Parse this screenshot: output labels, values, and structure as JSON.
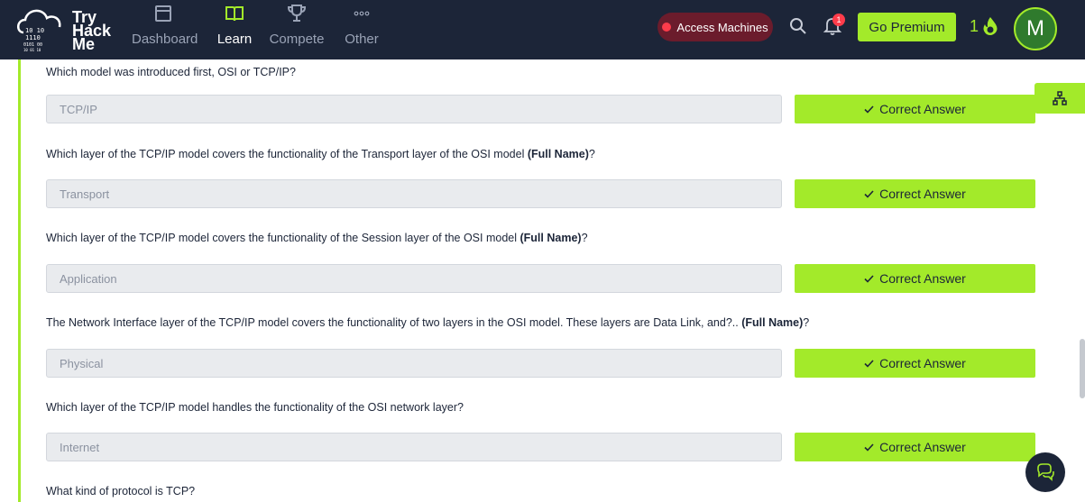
{
  "brand": {
    "word1": "Try",
    "word2": "Hack",
    "word3": "Me",
    "bits": [
      "10 10",
      "1110",
      "0101 00",
      "10 01 10"
    ]
  },
  "nav": [
    {
      "label": "Dashboard",
      "icon": "dashboard-icon",
      "active": false
    },
    {
      "label": "Learn",
      "icon": "book-icon",
      "active": true
    },
    {
      "label": "Compete",
      "icon": "trophy-icon",
      "active": false
    },
    {
      "label": "Other",
      "icon": "more-dots-icon",
      "active": false
    }
  ],
  "header": {
    "access_label": "Access Machines",
    "notification_count": "1",
    "premium_label": "Go Premium",
    "streak_count": "1",
    "avatar_initial": "M"
  },
  "questions": [
    {
      "prefix": "Which model was introduced first, OSI or TCP/IP?",
      "bold": "",
      "suffix": "",
      "answer": "TCP/IP",
      "button": "Correct Answer"
    },
    {
      "prefix": "Which layer of the TCP/IP model covers the functionality of the Transport layer of the OSI model ",
      "bold": "(Full Name)",
      "suffix": "?",
      "answer": "Transport",
      "button": "Correct Answer"
    },
    {
      "prefix": "Which layer of the TCP/IP model covers the functionality of the Session layer of the OSI model ",
      "bold": "(Full Name)",
      "suffix": "?",
      "answer": "Application",
      "button": "Correct Answer"
    },
    {
      "prefix": "The Network Interface layer of the TCP/IP model covers the functionality of two layers in the OSI model. These layers are Data Link, and?.. ",
      "bold": "(Full Name)",
      "suffix": "?",
      "answer": "Physical",
      "button": "Correct Answer"
    },
    {
      "prefix": "Which layer of the TCP/IP model handles the functionality of the OSI network layer?",
      "bold": "",
      "suffix": "",
      "answer": "Internet",
      "button": "Correct Answer"
    },
    {
      "prefix": "What kind of protocol is TCP?",
      "bold": "",
      "suffix": ""
    }
  ],
  "colors": {
    "nav_bg": "#1c2538",
    "accent": "#a3ea2a",
    "access_bg": "#6b1c2c",
    "alert": "#ff3c4b"
  }
}
